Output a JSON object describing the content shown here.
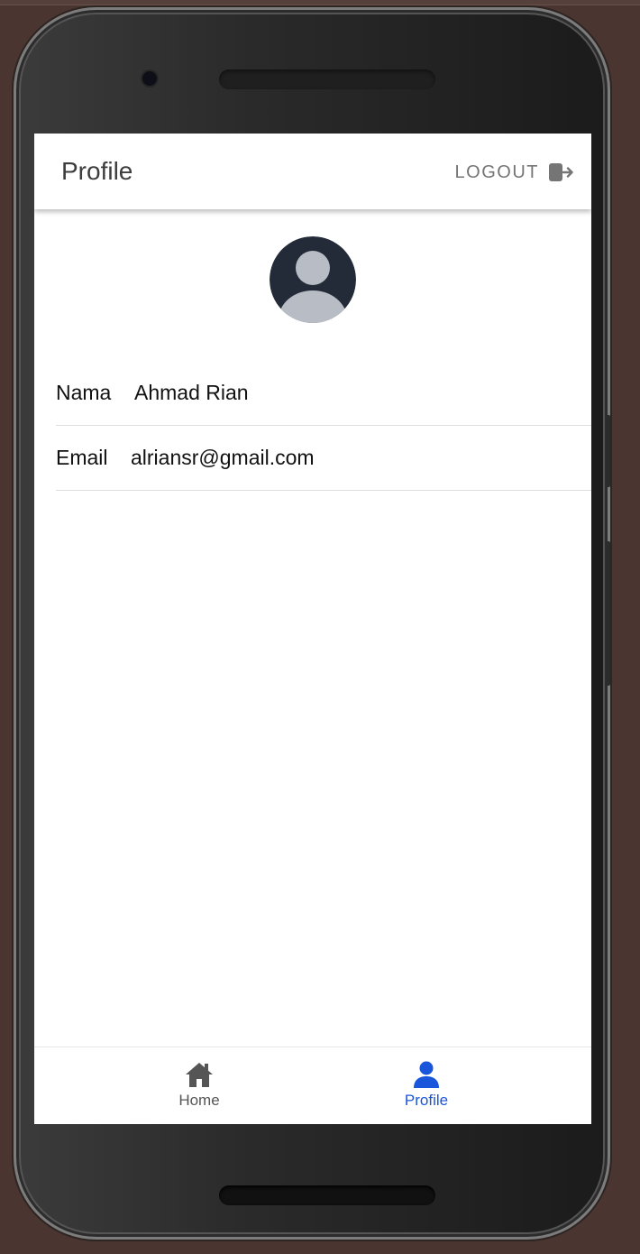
{
  "app": {
    "title": "Profile",
    "logout_label": "LOGOUT"
  },
  "profile": {
    "fields": [
      {
        "label": "Nama",
        "value": "Ahmad Rian"
      },
      {
        "label": "Email",
        "value": "alriansr@gmail.com"
      }
    ]
  },
  "bottom_nav": {
    "items": [
      {
        "label": "Home",
        "icon": "home-icon",
        "active": false
      },
      {
        "label": "Profile",
        "icon": "person-icon",
        "active": true
      }
    ]
  },
  "colors": {
    "accent": "#1a56db",
    "avatar_bg": "#232a38",
    "avatar_fg": "#b8bcc4",
    "frame_bg": "#4a3531"
  }
}
